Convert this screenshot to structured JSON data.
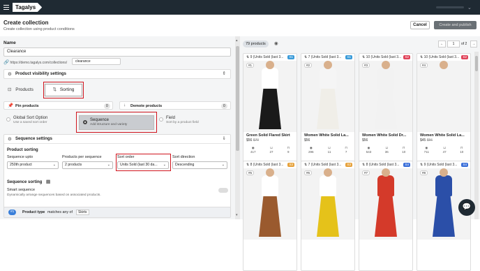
{
  "header": {
    "logo": "Tagalys"
  },
  "page": {
    "title": "Create collection",
    "subtitle": "Create collection using product conditions",
    "cancel": "Cancel",
    "publish": "Create and publish"
  },
  "form": {
    "name_label": "Name",
    "name_value": "Clearance",
    "url_prefix": "https://demo.tagalys.com/collections/",
    "url_slug": "clearance",
    "visibility": "Product visibility settings"
  },
  "tabs": {
    "products": "Products",
    "sorting": "Sorting"
  },
  "pin": {
    "pin_label": "Pin products",
    "pin_count": "0",
    "demote_label": "Demote products",
    "demote_count": "0"
  },
  "sort_options": [
    {
      "title": "Global Sort Option",
      "desc": "Use a saved sort order"
    },
    {
      "title": "Sequence",
      "desc": "Add structure and variety"
    },
    {
      "title": "Field",
      "desc": "Sort by a product field"
    }
  ],
  "sequence": {
    "heading": "Sequence settings",
    "product_sorting": "Product sorting",
    "upto_label": "Sequence upto",
    "upto_value": "250th product",
    "per_label": "Products per sequence",
    "per_value": "2 products",
    "order_label": "Sort order",
    "order_value": "Units Sold (last 30 da...",
    "dir_label": "Sort direction",
    "dir_value": "Descending",
    "seq_sorting": "Sequence sorting",
    "smart_title": "Smart sequence",
    "smart_desc": "Dynamically arrange sequences based on associated products."
  },
  "rule": {
    "num": "#1",
    "field": "Product type",
    "op": "matches any of",
    "value": "Skirts"
  },
  "results": {
    "count": "79 products",
    "page": "1",
    "of": "of 2"
  },
  "colors": {
    "topbar": "#1f2a33",
    "accent": "#1a73e8",
    "highlight": "#d0141d"
  },
  "products": [
    {
      "sold": "9 (Units Sold (last 3...",
      "badge": "S1",
      "bc": "#3a9bd9",
      "num": "#1",
      "name": "Green Solid Flared Skirt",
      "price": "$56",
      "old": "$70",
      "views": "417",
      "carts": "27",
      "buys": "9",
      "top": "#fff",
      "bottom": "#1a1a1a"
    },
    {
      "sold": "7 (Units Sold (last 3...",
      "badge": "S1",
      "bc": "#3a9bd9",
      "num": "#2",
      "name": "Women White Solid La...",
      "price": "$56",
      "old": "",
      "views": "296",
      "carts": "11",
      "buys": "7",
      "top": "#f5f5f5",
      "bottom": "#f0eee8"
    },
    {
      "sold": "10 (Units Sold (last 3...",
      "badge": "S2",
      "bc": "#e0445a",
      "num": "#3",
      "name": "Women White Solid Dr...",
      "price": "$56",
      "old": "",
      "views": "543",
      "carts": "36",
      "buys": "10",
      "top": "#f2f2f2",
      "bottom": "#f2f2f2"
    },
    {
      "sold": "10 (Units Sold (last 3...",
      "badge": "S2",
      "bc": "#e0445a",
      "num": "#4",
      "name": "Women White Solid La...",
      "price": "$45",
      "old": "$56",
      "views": "711",
      "carts": "47",
      "buys": "10",
      "top": "#f3f3f3",
      "bottom": "#f3f3f3"
    },
    {
      "sold": "8 (Units Sold (last 3...",
      "badge": "S3",
      "bc": "#e6a23c",
      "num": "#5",
      "name": "",
      "price": "",
      "old": "",
      "views": "",
      "carts": "",
      "buys": "",
      "top": "#fff",
      "bottom": "#9a5a2e"
    },
    {
      "sold": "7 (Units Sold (last 3...",
      "badge": "S3",
      "bc": "#e6a23c",
      "num": "#6",
      "name": "",
      "price": "",
      "old": "",
      "views": "",
      "carts": "",
      "buys": "",
      "top": "#fff",
      "bottom": "#e5c21a"
    },
    {
      "sold": "8 (Units Sold (last 3...",
      "badge": "S4",
      "bc": "#3a6fd9",
      "num": "#7",
      "name": "",
      "price": "",
      "old": "",
      "views": "",
      "carts": "",
      "buys": "",
      "top": "#d43a2a",
      "bottom": "#d43a2a"
    },
    {
      "sold": "9 (Units Sold (last 3...",
      "badge": "S4",
      "bc": "#3a6fd9",
      "num": "#8",
      "name": "",
      "price": "",
      "old": "",
      "views": "",
      "carts": "",
      "buys": "",
      "top": "#2b4fa8",
      "bottom": "#2b4fa8"
    }
  ]
}
